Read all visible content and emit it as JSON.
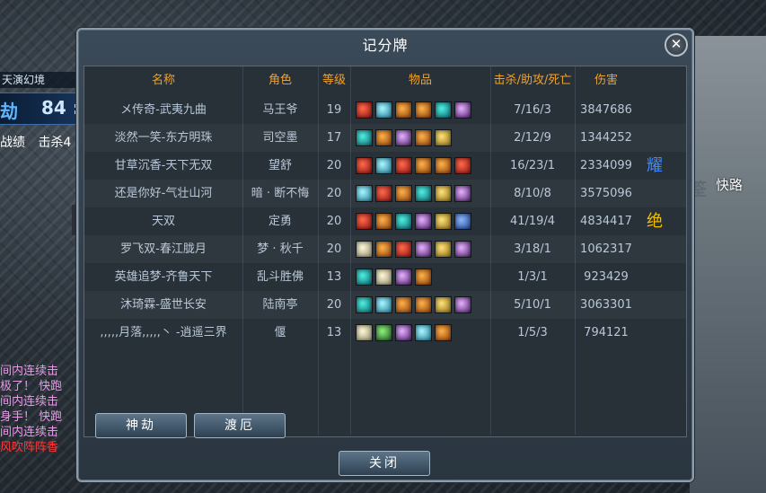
{
  "hud": {
    "zone": "天演幻境",
    "score_left": "劫",
    "score_right": "84 :",
    "tab1": "战绩",
    "tab2": "击杀4",
    "side_label": "快路",
    "side_mark": "筌",
    "chat": [
      {
        "text": "间内连续击",
        "color": "pink"
      },
      {
        "text": "极了！ 快跑",
        "color": "pink"
      },
      {
        "text": "间内连续击",
        "color": "pink"
      },
      {
        "text": "身手！ 快跑",
        "color": "pink"
      },
      {
        "text": "间内连续击",
        "color": "pink"
      },
      {
        "text": "风吹阵阵香",
        "color": "red"
      }
    ]
  },
  "panel": {
    "title": "记分牌",
    "close_icon_glyph": "✕",
    "headers": {
      "name": "名称",
      "role": "角色",
      "level": "等级",
      "items": "物品",
      "kda": "击杀/助攻/死亡",
      "damage": "伤害"
    },
    "rows": [
      {
        "name": "メ传奇-武夷九曲",
        "role": "马王爷",
        "level": "19",
        "kda": "7/16/3",
        "damage": "3847686",
        "badge": "",
        "items": [
          "red",
          "cyan",
          "orange",
          "orange",
          "teal",
          "purple"
        ]
      },
      {
        "name": "淡然一笑-东方明珠",
        "role": "司空墨",
        "level": "17",
        "kda": "2/12/9",
        "damage": "1344252",
        "badge": "",
        "items": [
          "teal",
          "orange",
          "purple",
          "orange",
          "gold"
        ]
      },
      {
        "name": "甘草沉香-天下无双",
        "role": "望舒",
        "level": "20",
        "kda": "16/23/1",
        "damage": "2334099",
        "badge": "耀",
        "items": [
          "red",
          "cyan",
          "red",
          "orange",
          "orange",
          "red"
        ]
      },
      {
        "name": "还是你好-气壮山河",
        "role": "暗 · 断不悔",
        "level": "20",
        "kda": "8/10/8",
        "damage": "3575096",
        "badge": "",
        "items": [
          "cyan",
          "red",
          "orange",
          "teal",
          "gold",
          "purple"
        ]
      },
      {
        "name": "天双",
        "role": "定勇",
        "level": "20",
        "kda": "41/19/4",
        "damage": "4834417",
        "badge": "绝",
        "items": [
          "red",
          "orange",
          "teal",
          "purple",
          "gold",
          "blue"
        ]
      },
      {
        "name": "罗飞双-春江胧月",
        "role": "梦 · 秋千",
        "level": "20",
        "kda": "3/18/1",
        "damage": "1062317",
        "badge": "",
        "items": [
          "white",
          "orange",
          "red",
          "purple",
          "gold",
          "purple"
        ]
      },
      {
        "name": "英雄追梦-齐鲁天下",
        "role": "乱斗胜佛",
        "level": "13",
        "kda": "1/3/1",
        "damage": "923429",
        "badge": "",
        "items": [
          "teal",
          "white",
          "purple",
          "orange"
        ]
      },
      {
        "name": "沐琦霖-盛世长安",
        "role": "陆南亭",
        "level": "20",
        "kda": "5/10/1",
        "damage": "3063301",
        "badge": "",
        "items": [
          "teal",
          "cyan",
          "orange",
          "orange",
          "gold",
          "purple"
        ]
      },
      {
        "name": ",,,,,月落,,,,,丶 -逍遥三界",
        "role": "偃",
        "level": "13",
        "kda": "1/5/3",
        "damage": "794121",
        "badge": "",
        "items": [
          "white",
          "green",
          "purple",
          "cyan",
          "orange"
        ]
      }
    ],
    "buttons": {
      "tab_shenjie": "神劫",
      "tab_due": "渡厄",
      "close": "关闭"
    }
  }
}
